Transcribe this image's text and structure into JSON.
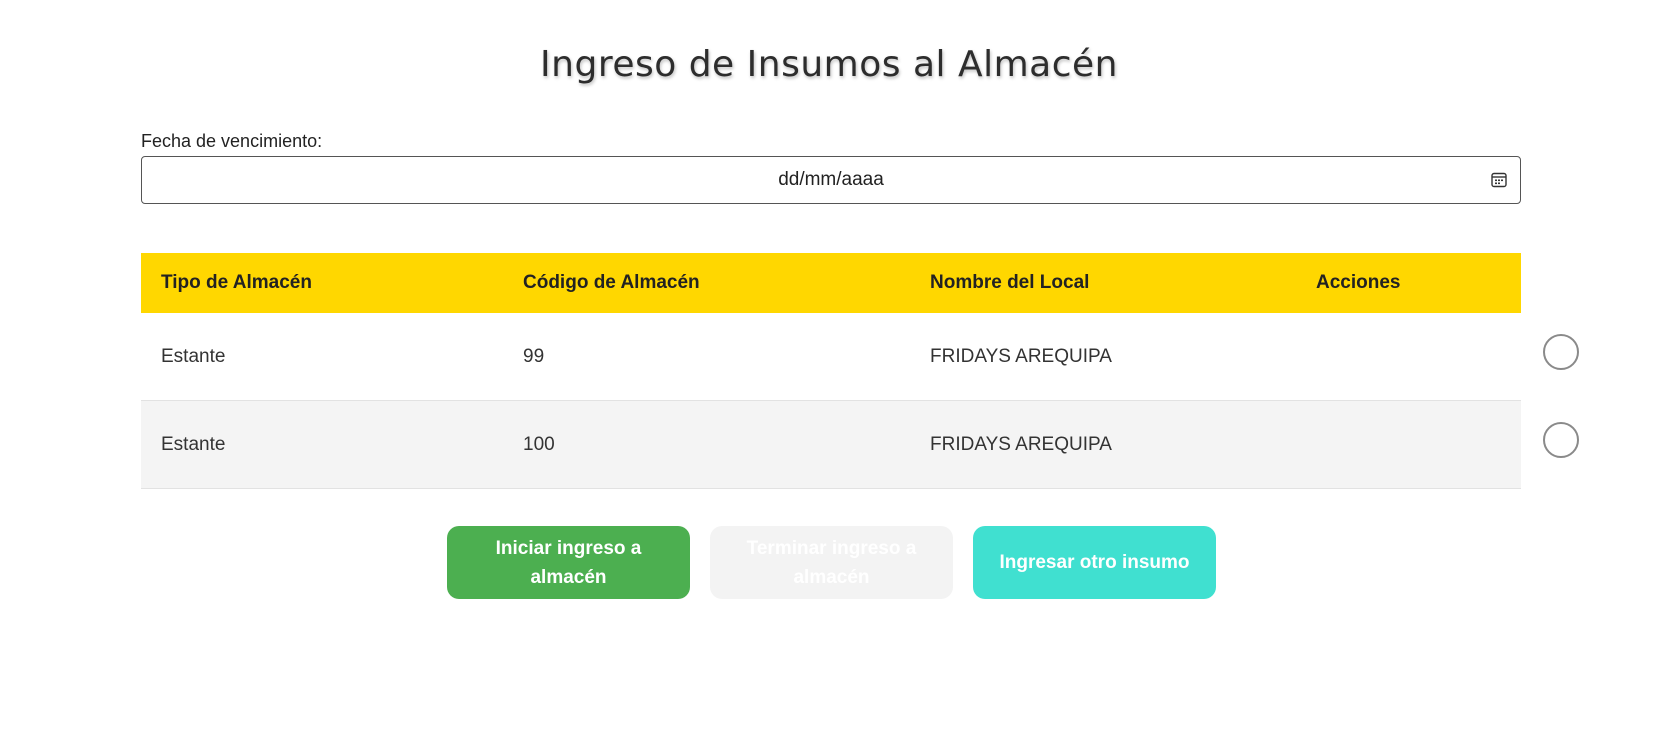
{
  "page": {
    "title": "Ingreso de Insumos al Almacén"
  },
  "date_field": {
    "label": "Fecha de vencimiento:",
    "placeholder": "dd/mm/aaaa",
    "icon": "calendar-icon"
  },
  "table": {
    "header_color": "#ffd700",
    "columns": [
      "Tipo de Almacén",
      "Código de Almacén",
      "Nombre del Local",
      "Acciones"
    ],
    "rows": [
      {
        "tipo": "Estante",
        "codigo": "99",
        "local": "FRIDAYS AREQUIPA",
        "selected": false
      },
      {
        "tipo": "Estante",
        "codigo": "100",
        "local": "FRIDAYS AREQUIPA",
        "selected": false
      }
    ]
  },
  "buttons": {
    "start_label": "Iniciar ingreso a almacén",
    "start_color": "#4caf50",
    "end_label": "Terminar ingreso a almacén",
    "end_color": "#f3f3f3",
    "other_label": "Ingresar otro insumo",
    "other_color": "#40e0d0"
  }
}
